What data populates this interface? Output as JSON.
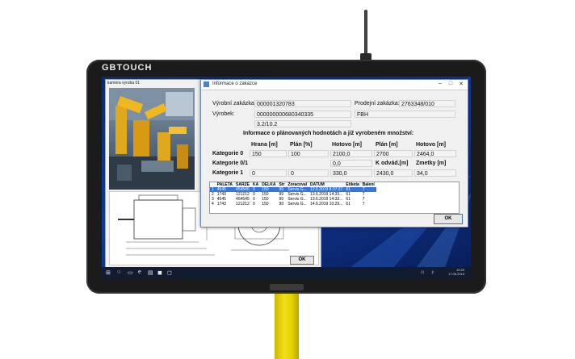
{
  "brand": "GBTOUCH",
  "camera_window": {
    "title": "kamera vyroba 01",
    "ok_label": "OK"
  },
  "dialog": {
    "title": "Informace o zakázce",
    "vyrobni_zakazka_label": "Výrobní zakázka:",
    "vyrobni_zakazka_value": "000001320783",
    "prodejni_zakazka_label": "Prodejní zakázka:",
    "prodejni_zakazka_value": "2763348/010",
    "vyrobek_label": "Výrobek:",
    "vyrobek_value": "000000000680340335",
    "vyrobek_code": "FBH",
    "vyrobek_dim": "3.2/10.2",
    "section_heading": "Informace o plánovaných hodnotách a již vyrobeném množství:",
    "col_headers": [
      "Hrana [m]",
      "Plán [%]",
      "Hotovo [m]",
      "Plán [m]",
      "Hotovo [m]"
    ],
    "rows": [
      {
        "label": "Kategorie 0",
        "hrana": "150",
        "plan_pct": "100",
        "hotovo": "2100,0",
        "plan_m": "2700",
        "hotovo_m": "2464,0"
      },
      {
        "label": "Kategorie 0/1",
        "hrana": "",
        "plan_pct": "",
        "hotovo": "0,0",
        "plan_m_label": "K odvád.[m]",
        "zmetky_label": "Zmetky [m]"
      },
      {
        "label": "Kategorie 1",
        "hrana": "0",
        "plan_pct": "0",
        "hotovo": "330,0",
        "k_odvad": "2430,0",
        "zmetky": "34,0"
      }
    ],
    "grid_headers": [
      "PALETA",
      "SARZE",
      "KA",
      "DELKA",
      "Str",
      "Zoracoval",
      "DATUM",
      "Etiketa",
      "Balení"
    ],
    "grid_rows": [
      [
        "4545",
        "454545",
        "0",
        "150",
        "99",
        "Servis G...",
        "12.6.2019 8:37:27",
        "61",
        "7"
      ],
      [
        "1743",
        "121212",
        "0",
        "150",
        "99",
        "Servis G...",
        "13.6.2019 14:33...",
        "61",
        "7"
      ],
      [
        "4545",
        "454545",
        "0",
        "150",
        "99",
        "Servis G...",
        "13.6.2019 14:33...",
        "61",
        "7"
      ],
      [
        "1743",
        "121212",
        "0",
        "150",
        "99",
        "Servis G...",
        "14.6.2019 10:29...",
        "61",
        "7"
      ]
    ],
    "row_numbers": [
      "1",
      "2",
      "3",
      "4"
    ],
    "ok_label": "OK"
  },
  "taskbar": {
    "time": "10:29",
    "date": "17.06.2019"
  },
  "colors": {
    "pole": "#f3df18",
    "bezel": "#1b1b1b",
    "desktop": "#0d3aa0",
    "selection": "#3377dd"
  }
}
